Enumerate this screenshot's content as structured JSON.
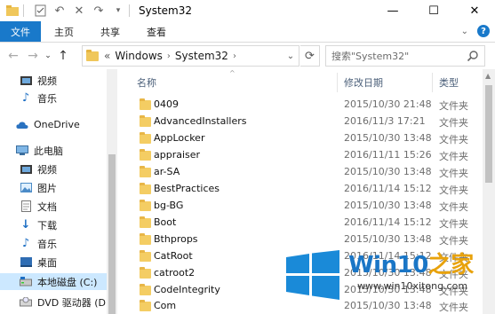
{
  "window": {
    "title": "System32",
    "controls": {
      "minimize": "—",
      "maximize": "☐",
      "close": "✕"
    }
  },
  "ribbon": {
    "tabs": [
      "文件",
      "主页",
      "共享",
      "查看"
    ]
  },
  "address": {
    "prefix": "«",
    "crumbs": [
      "Windows",
      "System32"
    ],
    "search_placeholder": "搜索\"System32\""
  },
  "nav_pane": {
    "items": [
      {
        "label": "视频",
        "icon": "video-icon"
      },
      {
        "label": "音乐",
        "icon": "music-icon"
      },
      {
        "label": "OneDrive",
        "icon": "cloud-icon"
      },
      {
        "label": "此电脑",
        "icon": "computer-icon"
      },
      {
        "label": "视频",
        "icon": "video-icon"
      },
      {
        "label": "图片",
        "icon": "pictures-icon"
      },
      {
        "label": "文档",
        "icon": "documents-icon"
      },
      {
        "label": "下载",
        "icon": "download-icon"
      },
      {
        "label": "音乐",
        "icon": "music-icon"
      },
      {
        "label": "桌面",
        "icon": "desktop-icon"
      },
      {
        "label": "本地磁盘 (C:)",
        "icon": "drive-icon",
        "selected": true
      },
      {
        "label": "DVD 驱动器 (D:",
        "icon": "dvd-icon"
      }
    ]
  },
  "file_list": {
    "columns": {
      "name": "名称",
      "date": "修改日期",
      "type": "类型"
    },
    "rows": [
      {
        "name": "0409",
        "date": "2015/10/30 21:48",
        "type": "文件夹"
      },
      {
        "name": "AdvancedInstallers",
        "date": "2016/11/3 17:21",
        "type": "文件夹"
      },
      {
        "name": "AppLocker",
        "date": "2015/10/30 13:48",
        "type": "文件夹"
      },
      {
        "name": "appraiser",
        "date": "2016/11/11 15:26",
        "type": "文件夹"
      },
      {
        "name": "ar-SA",
        "date": "2015/10/30 13:48",
        "type": "文件夹"
      },
      {
        "name": "BestPractices",
        "date": "2016/11/14 15:12",
        "type": "文件夹"
      },
      {
        "name": "bg-BG",
        "date": "2015/10/30 13:48",
        "type": "文件夹"
      },
      {
        "name": "Boot",
        "date": "2016/11/14 15:12",
        "type": "文件夹"
      },
      {
        "name": "Bthprops",
        "date": "2015/10/30 13:48",
        "type": "文件夹"
      },
      {
        "name": "CatRoot",
        "date": "2016/11/14 15:12",
        "type": "文件夹"
      },
      {
        "name": "catroot2",
        "date": "2015/10/30 13:48",
        "type": "文件夹"
      },
      {
        "name": "CodeIntegrity",
        "date": "2015/10/30 13:48",
        "type": "文件夹"
      },
      {
        "name": "Com",
        "date": "2015/10/30 13:48",
        "type": "文件夹"
      }
    ]
  },
  "watermark": {
    "title_main": "Win10",
    "title_accent": "之家",
    "url": "www.win10xitong.com"
  },
  "colors": {
    "accent": "#1979ca",
    "folder": "#f4cd63",
    "selection": "#cce8ff",
    "watermark_blue": "#1a76c6",
    "watermark_orange": "#e8a20c"
  }
}
